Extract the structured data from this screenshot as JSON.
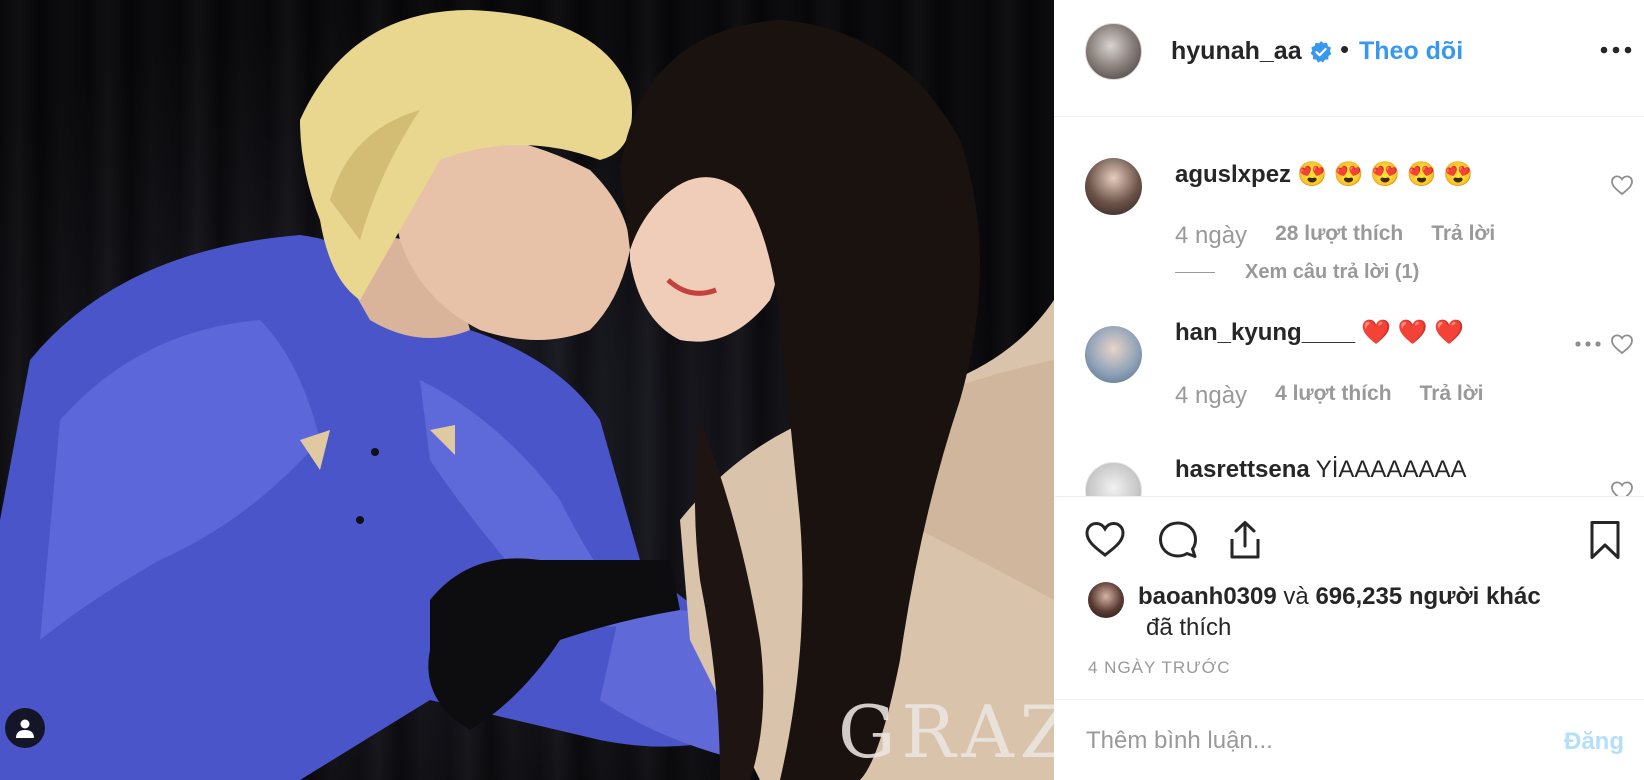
{
  "post": {
    "image_watermark": "GRAZIA",
    "header": {
      "username": "hyunah_aa",
      "verified": true,
      "separator": "•",
      "follow_label": "Theo dõi"
    },
    "comments": [
      {
        "username": "aguslxpez",
        "text": "😍 😍 😍 😍 😍",
        "age": "4 ngày",
        "likes": "28 lượt thích",
        "reply_label": "Trả lời",
        "view_replies": "Xem câu trả lời (1)"
      },
      {
        "username": "han_kyung____",
        "text": "❤️ ❤️ ❤️",
        "age": "4 ngày",
        "likes": "4 lượt thích",
        "reply_label": "Trả lời"
      },
      {
        "username": "hasrettsena",
        "text": "YİAAAAAAAA"
      }
    ],
    "likes": {
      "liker": "baoanh0309",
      "connector": "và",
      "others": "696,235 người khác",
      "suffix": "đã thích"
    },
    "timestamp": "4 NGÀY TRƯỚC",
    "add_comment": {
      "placeholder": "Thêm bình luận...",
      "post_label": "Đăng"
    }
  },
  "icons": {
    "verified": "verified-badge-icon",
    "more": "more-options-icon",
    "heart": "heart-icon",
    "comment": "comment-icon",
    "share": "share-icon",
    "save": "bookmark-icon",
    "user_tag": "user-tag-icon"
  },
  "colors": {
    "link_blue": "#3897f0",
    "post_disabled": "#b2dffc",
    "muted": "#999999",
    "text": "#262626"
  }
}
